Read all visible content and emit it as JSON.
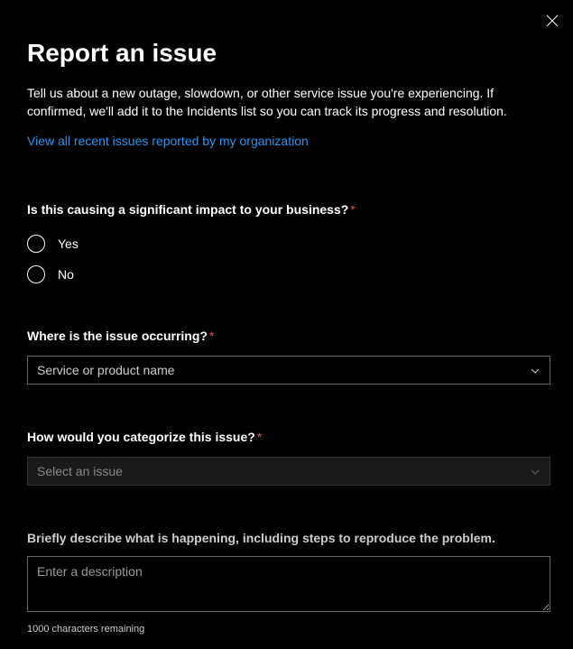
{
  "title": "Report an issue",
  "description": "Tell us about a new outage, slowdown, or other service issue you're experiencing. If confirmed, we'll add it to the Incidents list so you can track its progress and resolution.",
  "link": "View all recent issues reported by my organization",
  "impact": {
    "label": "Is this causing a significant impact to your business?",
    "options": {
      "yes": "Yes",
      "no": "No"
    }
  },
  "where": {
    "label": "Where is the issue occurring?",
    "placeholder": "Service or product name"
  },
  "categorize": {
    "label": "How would you categorize this issue?",
    "placeholder": "Select an issue"
  },
  "describe": {
    "label": "Briefly describe what is happening, including steps to reproduce the problem.",
    "placeholder": "Enter a description",
    "char_count": "1000 characters remaining"
  }
}
